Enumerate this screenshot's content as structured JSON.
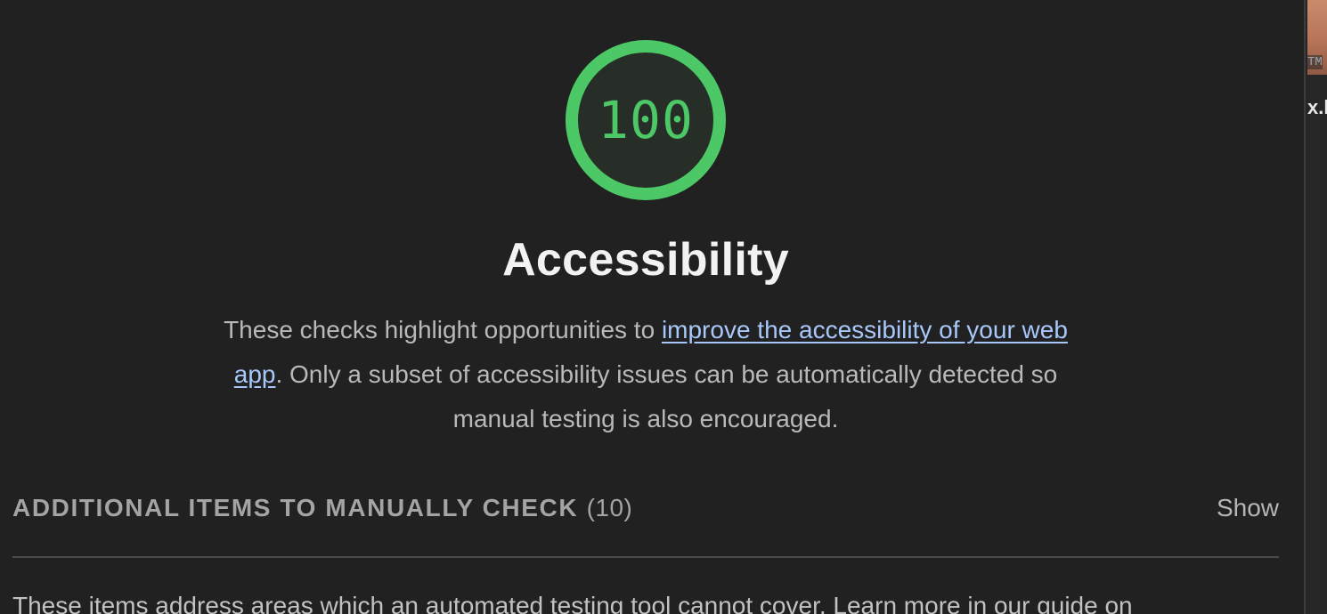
{
  "category": {
    "score": "100",
    "score_fraction": 1.0,
    "title": "Accessibility",
    "description_prefix": "These checks highlight opportunities to ",
    "description_link": "improve the accessibility of your web app",
    "description_suffix": ". Only a subset of accessibility issues can be automatically detected so manual testing is also encouraged."
  },
  "manual_checks": {
    "title": "Additional items to manually check",
    "count": "(10)",
    "toggle_label": "Show",
    "description": "These items address areas which an automated testing tool cannot cover. Learn more in our guide on"
  },
  "side_window": {
    "thumb_label": "TM",
    "filename_fragment": "x.l"
  },
  "colors": {
    "background": "#212121",
    "score_pass": "#4cc866",
    "gauge_fill": "#272d27",
    "link": "#a8c7fa",
    "muted_text": "#a4a4a4",
    "divider": "#4a4a4a"
  },
  "icons": {
    "gauge": "score-gauge-ring"
  }
}
